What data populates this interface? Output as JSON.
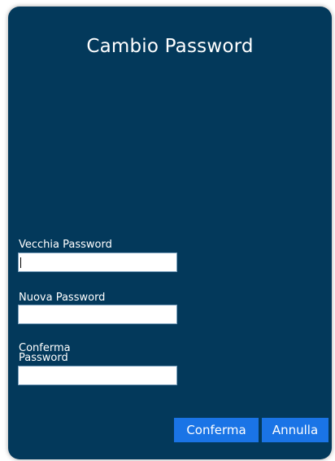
{
  "dialog": {
    "title": "Cambio Password"
  },
  "form": {
    "old_password_label": "Vecchia Password",
    "old_password_value": "",
    "new_password_label": "Nuova Password",
    "new_password_value": "",
    "confirm_password_label_line1": "Conferma",
    "confirm_password_label_line2": "Password",
    "confirm_password_value": ""
  },
  "buttons": {
    "confirm_label": "Conferma",
    "cancel_label": "Annulla"
  },
  "colors": {
    "dialog_background": "#03395b",
    "button_background": "#1a74e6",
    "text": "#ffffff"
  }
}
